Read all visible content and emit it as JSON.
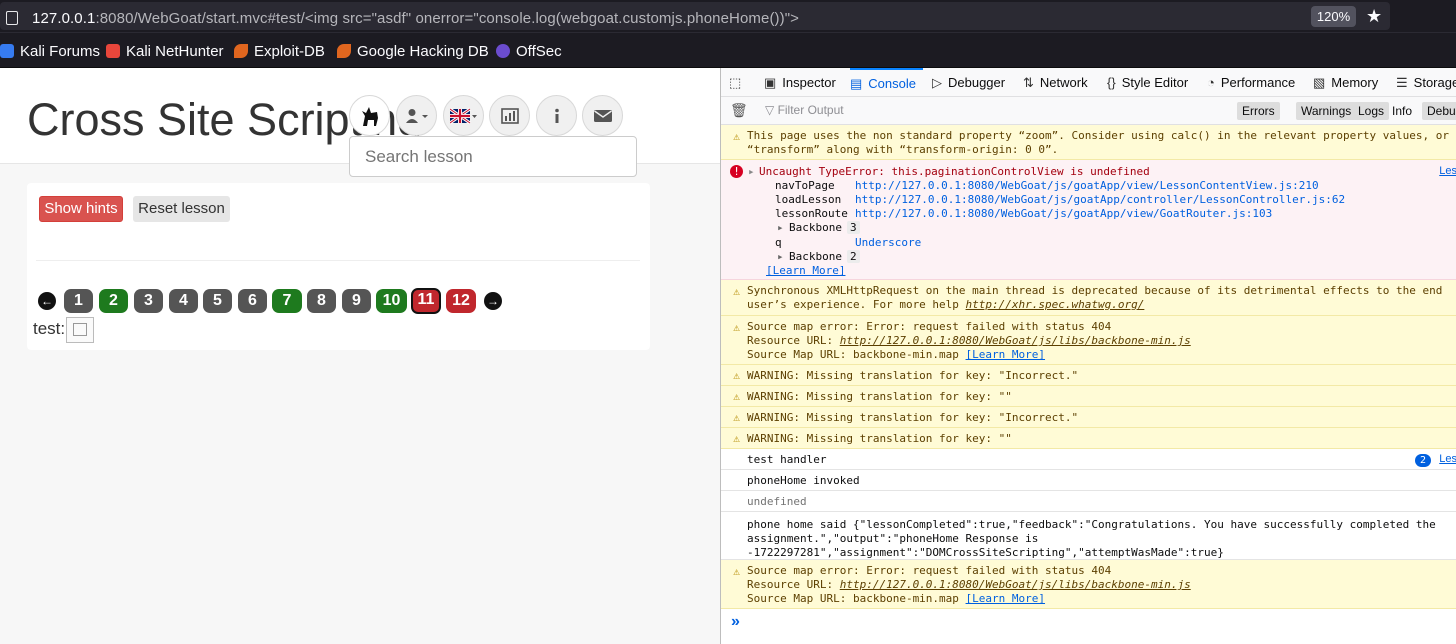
{
  "browser": {
    "url_host": "127.0.0.1",
    "url_rest": ":8080/WebGoat/start.mvc#test/<img src=\"asdf\" onerror=\"console.log(webgoat.customjs.phoneHome())\">",
    "zoom": "120%",
    "star_icon": "★",
    "bookmarks": [
      {
        "label": "Kali Forums",
        "color": "#367bf0"
      },
      {
        "label": "Kali NetHunter",
        "color": "#e8463b"
      },
      {
        "label": "Exploit-DB",
        "color": "#e0661f"
      },
      {
        "label": "Google Hacking DB",
        "color": "#e0661f"
      },
      {
        "label": "OffSec",
        "color": "#6b4ccf"
      }
    ]
  },
  "page": {
    "title": "Cross Site Scripting",
    "search_placeholder": "Search lesson",
    "show_hints": "Show hints",
    "reset_lesson": "Reset lesson",
    "pages": [
      {
        "n": "1",
        "state": "gray"
      },
      {
        "n": "2",
        "state": "green"
      },
      {
        "n": "3",
        "state": "gray"
      },
      {
        "n": "4",
        "state": "gray"
      },
      {
        "n": "5",
        "state": "gray"
      },
      {
        "n": "6",
        "state": "gray"
      },
      {
        "n": "7",
        "state": "green"
      },
      {
        "n": "8",
        "state": "gray"
      },
      {
        "n": "9",
        "state": "gray"
      },
      {
        "n": "10",
        "state": "green"
      },
      {
        "n": "11",
        "state": "red-current"
      },
      {
        "n": "12",
        "state": "red"
      }
    ],
    "test_label": "test:"
  },
  "devtools": {
    "tabs": [
      "Inspector",
      "Console",
      "Debugger",
      "Network",
      "Style Editor",
      "Performance",
      "Memory",
      "Storage"
    ],
    "active_tab": "Console",
    "filter_placeholder": "Filter Output",
    "filter_buttons": [
      "Errors",
      "Warnings",
      "Logs",
      "Info",
      "Debug"
    ],
    "messages": {
      "zoom_warn_1": "This page uses the non standard property “zoom”. Consider using calc() in the relevant property values, or using",
      "zoom_warn_2": "“transform” along with “transform-origin: 0 0”.",
      "error_title": "Uncaught TypeError: this.paginationControlView is undefined",
      "stack": [
        {
          "fn": "navToPage  ",
          "src": "http://127.0.0.1:8080/WebGoat/js/goatApp/view/LessonContentView.js:210"
        },
        {
          "fn": "loadLesson ",
          "src": "http://127.0.0.1:8080/WebGoat/js/goatApp/controller/LessonController.js:62"
        },
        {
          "fn": "lessonRoute",
          "src": "http://127.0.0.1:8080/WebGoat/js/goatApp/view/GoatRouter.js:103"
        }
      ],
      "backbone_1": "Backbone",
      "backbone_1_count": "3",
      "q_fn": "q",
      "q_src": "Underscore",
      "backbone_2": "Backbone",
      "backbone_2_count": "2",
      "learn_more": "[Learn More]",
      "les": "Les",
      "xhr_1": "Synchronous XMLHttpRequest on the main thread is deprecated because of its detrimental effects to the end",
      "xhr_2": "user’s experience. For more help ",
      "xhr_link": "http://xhr.spec.whatwg.org/",
      "srcmap_1": "Source map error: Error: request failed with status 404",
      "srcmap_2": "Resource URL: ",
      "srcmap_url": "http://127.0.0.1:8080/WebGoat/js/libs/backbone-min.js",
      "srcmap_3": "Source Map URL: backbone-min.map ",
      "warn_incorrect": "WARNING: Missing translation for key: \"Incorrect.\"",
      "warn_empty": "WARNING: Missing translation for key: \"\"",
      "test_handler": "test handler",
      "test_handler_count": "2",
      "phone_invoked": "phoneHome invoked",
      "undefined": "undefined",
      "phone_said_1": "phone home said {\"lessonCompleted\":true,\"feedback\":\"Congratulations. You have successfully completed the",
      "phone_said_2": "assignment.\",\"output\":\"phoneHome Response is",
      "phone_said_3": "-1722297281\",\"assignment\":\"DOMCrossSiteScripting\",\"attemptWasMade\":true}",
      "prompt": "»"
    }
  }
}
